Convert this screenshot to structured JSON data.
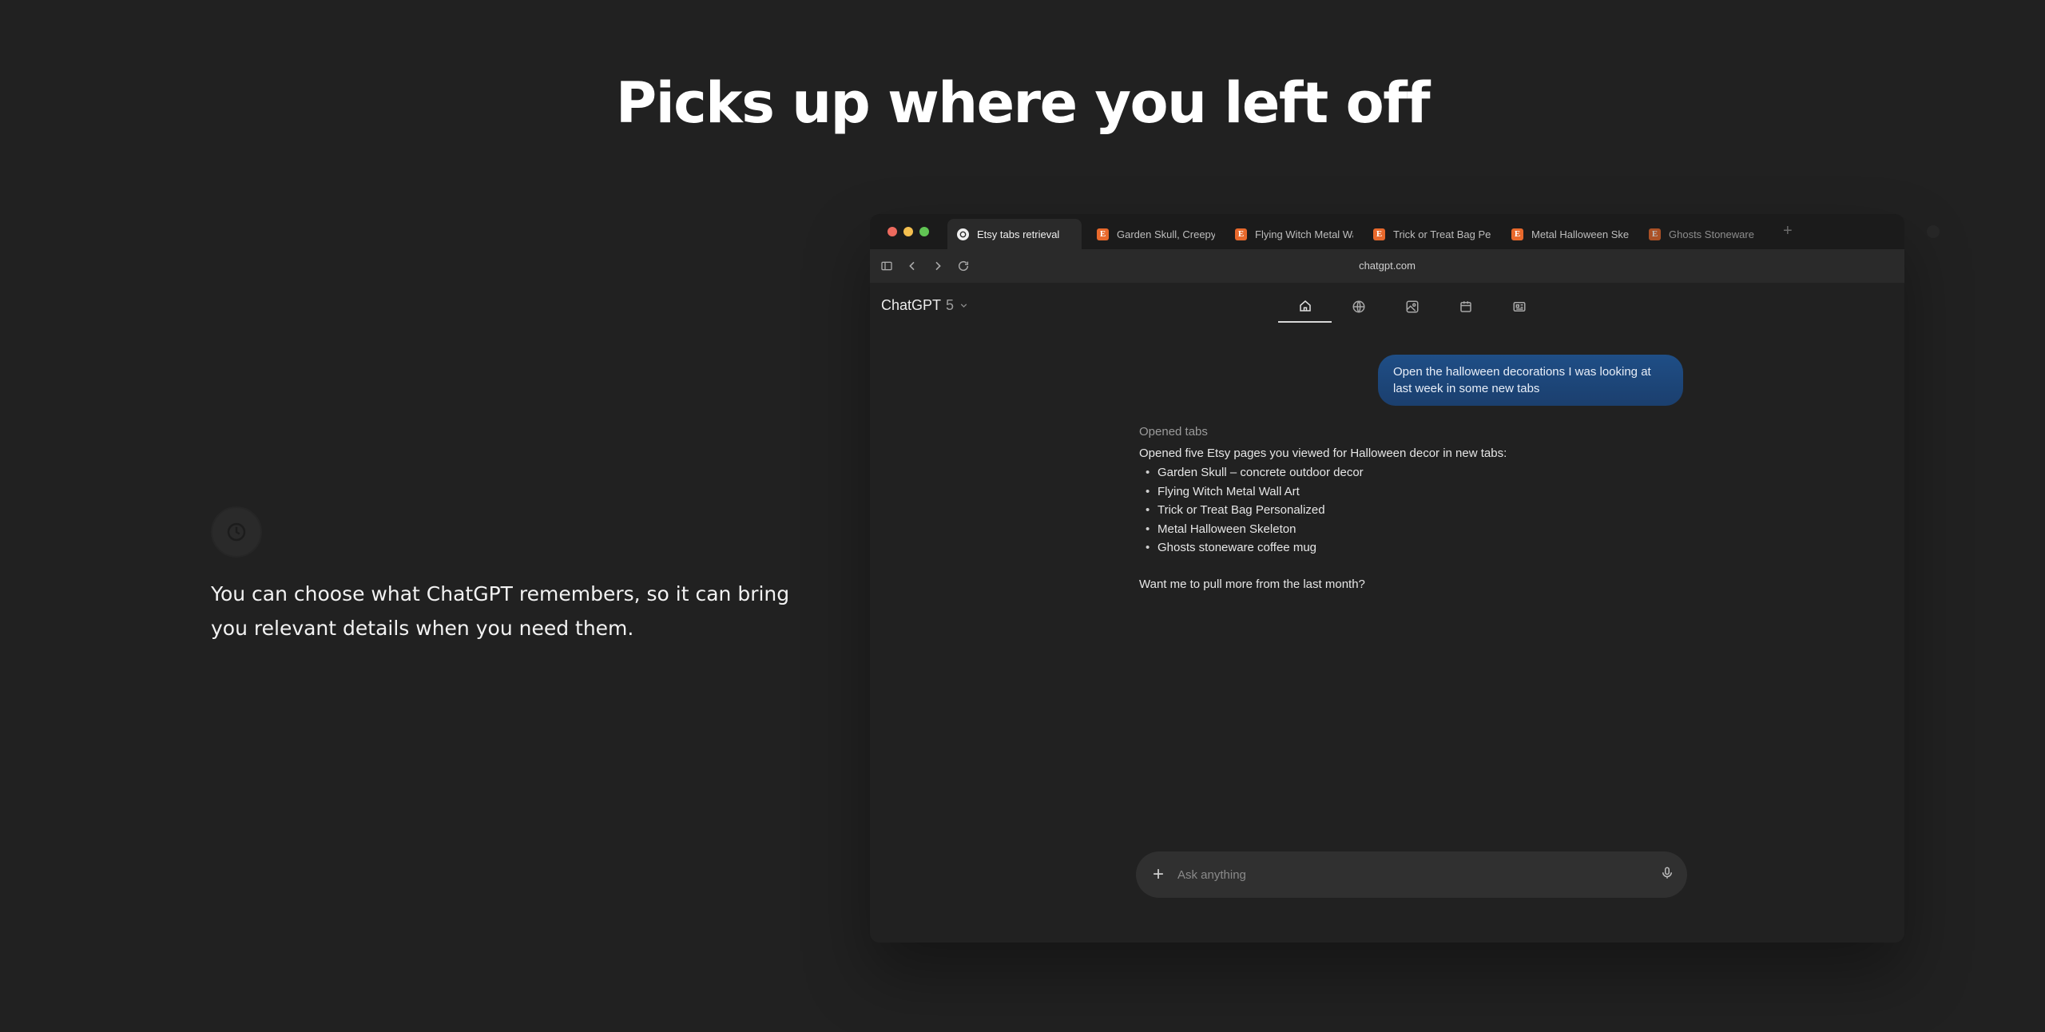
{
  "hero": {
    "headline": "Picks up where you left off",
    "description": "You can choose what ChatGPT remembers, so it can bring you relevant details when you need them."
  },
  "browser": {
    "tabs": [
      {
        "label": "Etsy tabs retrieval",
        "active": true,
        "icon": "chatgpt-logo-icon"
      },
      {
        "label": "Garden Skull, Creepy Concrete",
        "icon": "etsy-icon"
      },
      {
        "label": "Flying Witch Metal Wall Art",
        "icon": "etsy-icon"
      },
      {
        "label": "Trick or Treat Bag Personalized",
        "icon": "etsy-icon"
      },
      {
        "label": "Metal Halloween Skeleton",
        "icon": "etsy-icon"
      },
      {
        "label": "Ghosts Stoneware",
        "icon": "etsy-icon"
      }
    ],
    "new_tab": "+",
    "url": "chatgpt.com",
    "etsy_letter": "E"
  },
  "app": {
    "model_name": "ChatGPT",
    "model_version": "5",
    "nav": [
      "home-icon",
      "globe-icon",
      "image-icon",
      "calendar-icon",
      "news-icon"
    ]
  },
  "chat": {
    "user_message": "Open the halloween decorations I was looking at last week in some new tabs",
    "assistant": {
      "label": "Opened tabs",
      "intro": "Opened five Etsy pages you viewed for Halloween decor in new tabs:",
      "items": [
        "Garden Skull – concrete outdoor decor",
        "Flying Witch Metal Wall Art",
        "Trick or Treat Bag Personalized",
        "Metal Halloween Skeleton",
        "Ghosts stoneware coffee mug"
      ],
      "followup": "Want me to pull more from the last month?"
    }
  },
  "composer": {
    "placeholder": "Ask anything",
    "plus": "+"
  },
  "colors": {
    "background": "#212121",
    "user_bubble": "#1f4e86",
    "etsy_orange": "#e8692c",
    "traffic_red": "#ed6a5e",
    "traffic_yellow": "#f4bf4f",
    "traffic_green": "#61c554"
  }
}
